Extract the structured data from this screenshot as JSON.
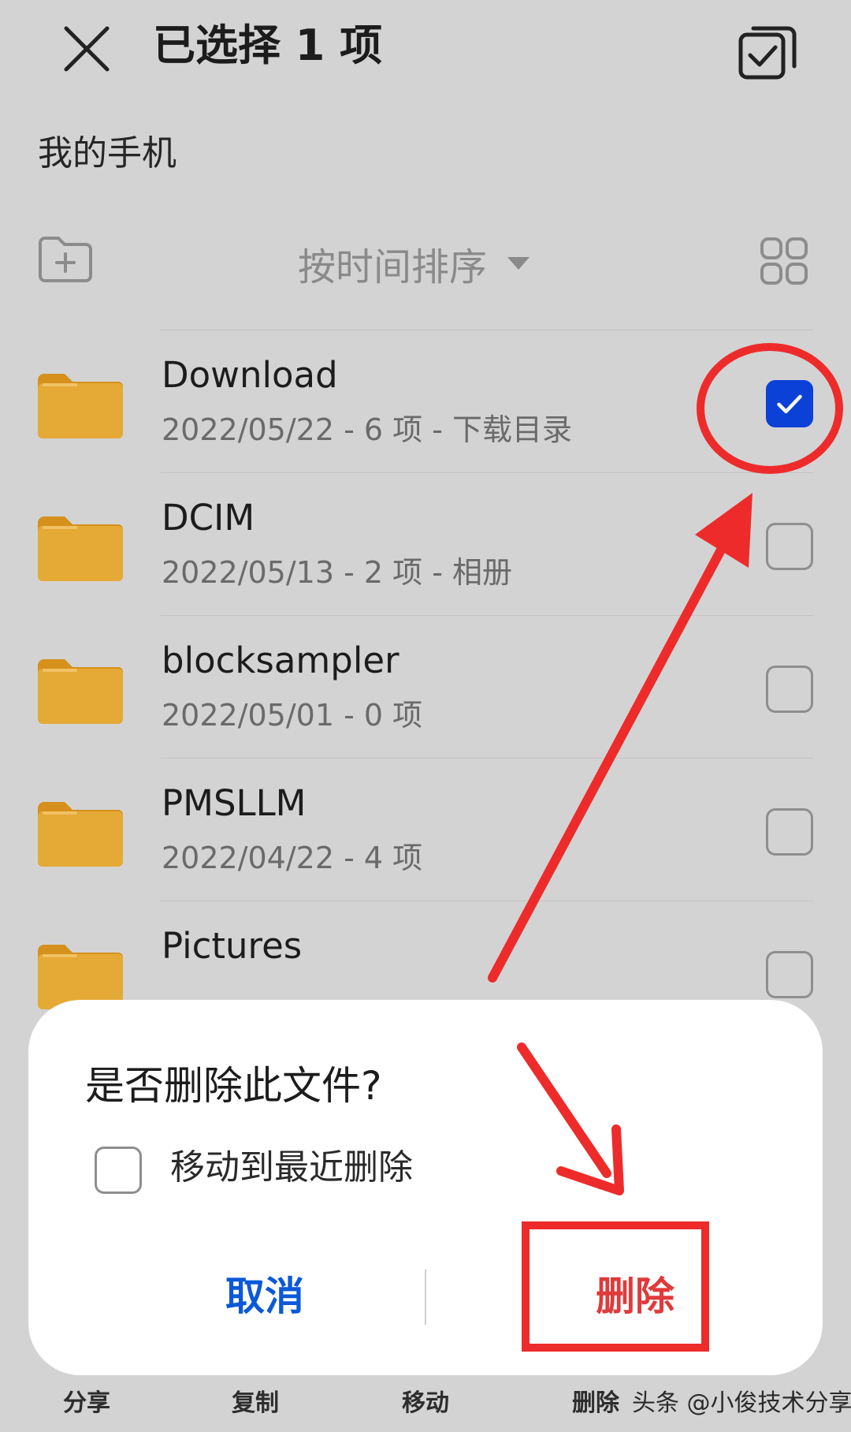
{
  "header": {
    "title": "已选择 1 项",
    "close_icon": "close-icon",
    "select_all_icon": "select-all-icon"
  },
  "breadcrumb": "我的手机",
  "toolbar": {
    "sort_label": "按时间排序",
    "new_folder_icon": "new-folder-icon",
    "grid_view_icon": "grid-view-icon"
  },
  "folders": [
    {
      "name": "Download",
      "meta": "2022/05/22 - 6 项 - 下载目录",
      "checked": true
    },
    {
      "name": "DCIM",
      "meta": "2022/05/13 - 2 项 - 相册",
      "checked": false
    },
    {
      "name": "blocksampler",
      "meta": "2022/05/01 - 0 项",
      "checked": false
    },
    {
      "name": "PMSLLM",
      "meta": "2022/04/22 - 4 项",
      "checked": false
    },
    {
      "name": "Pictures",
      "meta": "",
      "checked": false
    }
  ],
  "dialog": {
    "title": "是否删除此文件?",
    "checkbox_label": "移动到最近删除",
    "cancel_label": "取消",
    "delete_label": "删除"
  },
  "bottom_bar": {
    "share": "分享",
    "copy": "复制",
    "move": "移动",
    "delete": "删除",
    "watermark": "头条 @小俊技术分享"
  },
  "colors": {
    "folder": "#e5a935",
    "folder_tab": "#d6901c",
    "checkbox_checked": "#0b41d6",
    "cancel": "#0b59d8",
    "delete": "#e03a3a",
    "annotation": "#ee2b2b"
  }
}
